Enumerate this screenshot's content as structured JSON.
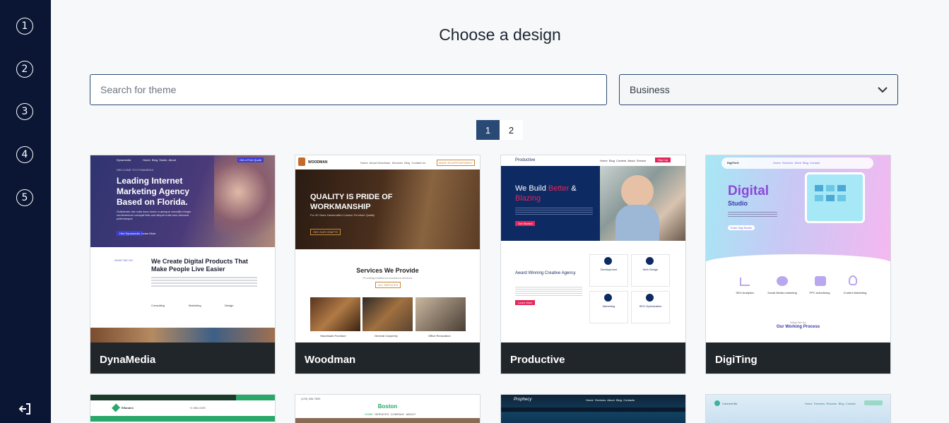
{
  "sidebar": {
    "steps": [
      "1",
      "2",
      "3",
      "4",
      "5"
    ],
    "exit_icon": "logout-icon"
  },
  "header": {
    "title": "Choose a design"
  },
  "search": {
    "placeholder": "Search for theme"
  },
  "category_select": {
    "value": "Business",
    "icon": "chevron-down-icon"
  },
  "pagination": {
    "pages": [
      "1",
      "2"
    ],
    "current": "1"
  },
  "themes": [
    {
      "name": "DynaMedia",
      "preview": {
        "brand": "Dynamedia",
        "nav": [
          "Home",
          "Blog",
          "Studio",
          "About"
        ],
        "cta": "Get a Free Quote",
        "welcome": "WELCOME TO DYNAMEDIA",
        "headline": "Leading Internet Marketing Agency Based on Florida.",
        "body": "Sollicitudin nisi nulla risus donec a quisque convallis integer condimentum volutpat felis and aliquet nulla sem dictumst pellentesque",
        "button": "Hire Dynamedia",
        "link": "Learn More",
        "what_we_do": "WHAT WE DO",
        "section_title": "We Create Digital Products That Make People Live Easier",
        "services": [
          "Consulting",
          "Marketing",
          "Design"
        ]
      }
    },
    {
      "name": "Woodman",
      "preview": {
        "brand": "WOODMAN",
        "nav": [
          "Home",
          "About Woodman",
          "Services",
          "Blog",
          "Contact Us"
        ],
        "cta": "MAKE AN APPOINTMENT",
        "headline": "QUALITY IS PRIDE OF WORKMANSHIP",
        "body": "For 30 Years Handcrafted Custom Furniture Quality",
        "button": "SEE OUR CRAFTS",
        "section_title": "Services We Provide",
        "section_body": "Providing traditional woodwork services",
        "section_button": "ALL SERVICES",
        "services": [
          "Handmade Furniture",
          "General Carpentry",
          "Office Renovation"
        ]
      }
    },
    {
      "name": "Productive",
      "preview": {
        "brand": "Productive",
        "nav": [
          "Home",
          "Blog",
          "Content",
          "About",
          "Service"
        ],
        "cta": "Sign Up",
        "headline_a": "We Build",
        "headline_b": "Better",
        "headline_c": "&",
        "headline_d": "Blazing",
        "button": "Get Started",
        "section_title": "Award Winning Creative Agency",
        "section_button": "Learn More",
        "features": [
          "Development",
          "Web Design",
          "Marketing",
          "SEO Optimization"
        ]
      }
    },
    {
      "name": "DigiTing",
      "preview": {
        "brand": "DigiTinG",
        "nav": [
          "Home",
          "Services",
          "Work",
          "Blog",
          "Contact"
        ],
        "headline_a": "Digital",
        "headline_b": "Studio",
        "button": "Enter Digi Studio",
        "features": [
          "SEO Analytics",
          "Social Media marketing",
          "PPC Advertising",
          "Content Marketing"
        ],
        "work_label": "What We Do",
        "section_title": "Our Working Process"
      }
    }
  ],
  "themes_row2": [
    {
      "brand": "Elfanden",
      "ribbon_phone": "+1 555-0199"
    },
    {
      "brand": "Boston",
      "phone": "(123) 456-7890",
      "nav": [
        "HOME",
        "SERVICES",
        "COMPANY",
        "ABOUT"
      ]
    },
    {
      "brand": "Prophecy",
      "nav": [
        "Home",
        "Services",
        "About",
        "Blog",
        "Contacts"
      ]
    },
    {
      "brand": "Connect Me",
      "nav": [
        "Home",
        "Services",
        "Resume",
        "Blog",
        "Contact"
      ]
    }
  ],
  "colors": {
    "sidebar": "#0b1634",
    "accent": "#284a74",
    "card_footer": "#21262b"
  }
}
